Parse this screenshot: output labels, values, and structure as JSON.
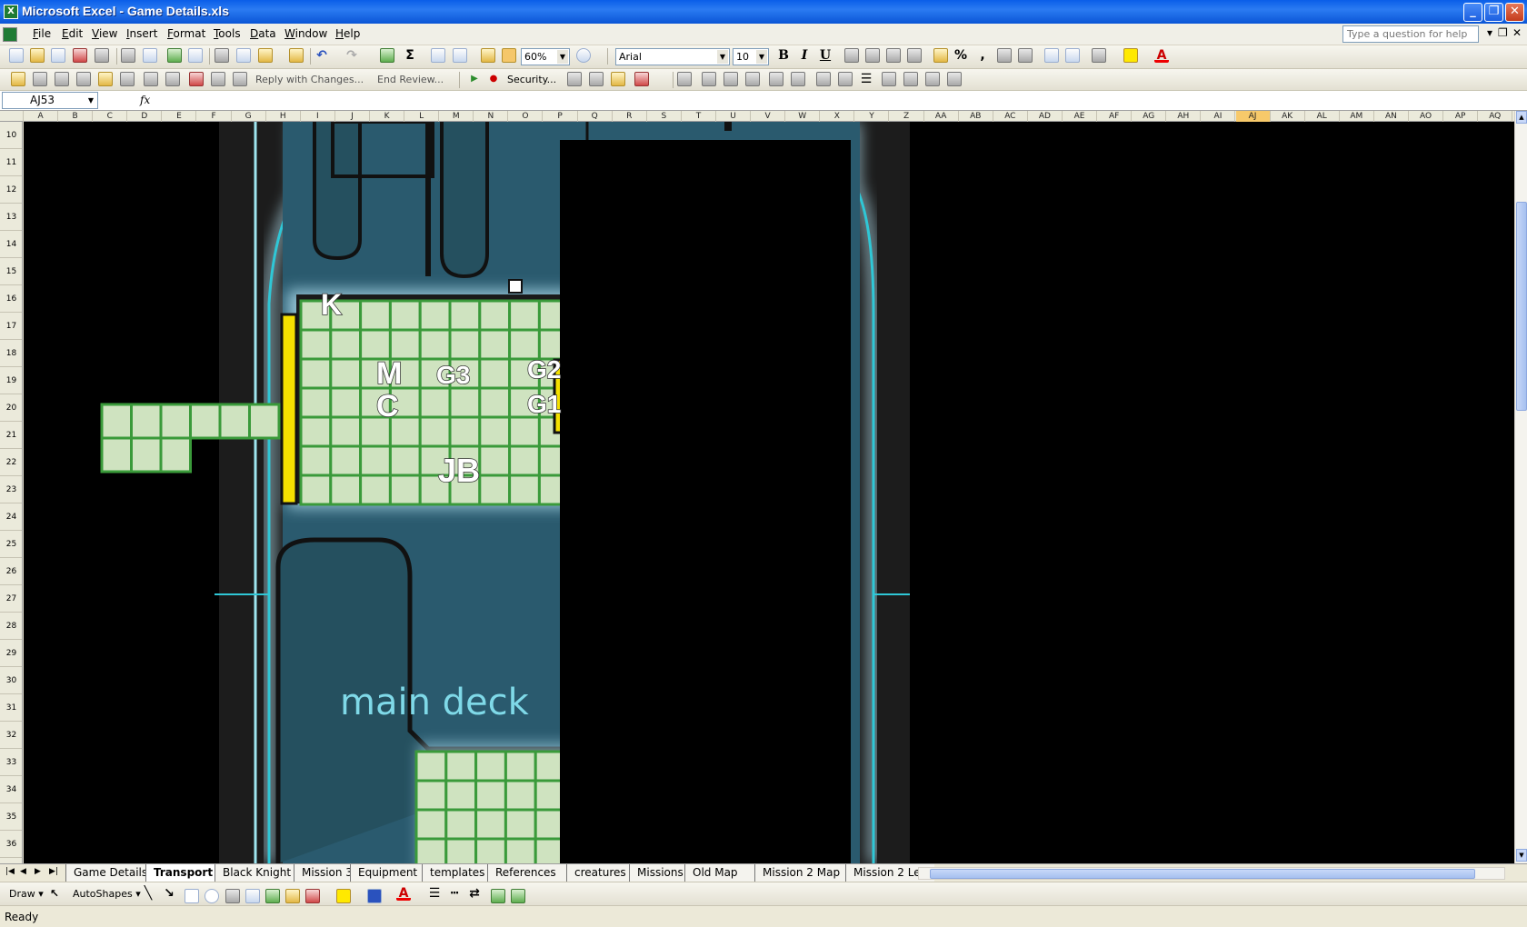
{
  "window": {
    "title": "Microsoft Excel - Game Details.xls",
    "app_icon": "excel-icon"
  },
  "menubar": {
    "items": [
      "File",
      "Edit",
      "View",
      "Insert",
      "Format",
      "Tools",
      "Data",
      "Window",
      "Help"
    ],
    "help_placeholder": "Type a question for help"
  },
  "toolbar_standard": {
    "zoom": "60%"
  },
  "toolbar_formatting": {
    "font": "Arial",
    "size": "10",
    "bold": "B",
    "italic": "I",
    "underline": "U",
    "percent": "%",
    "comma": ","
  },
  "toolbar_reviewing": {
    "reply": "Reply with Changes...",
    "end_review": "End Review...",
    "security": "Security..."
  },
  "formula_bar": {
    "cell_ref": "AJ53",
    "fx": "fx",
    "content": ""
  },
  "columns": [
    "A",
    "B",
    "C",
    "D",
    "E",
    "F",
    "G",
    "H",
    "I",
    "J",
    "K",
    "L",
    "M",
    "N",
    "O",
    "P",
    "Q",
    "R",
    "S",
    "T",
    "U",
    "V",
    "W",
    "X",
    "Y",
    "Z",
    "AA",
    "AB",
    "AC",
    "AD",
    "AE",
    "AF",
    "AG",
    "AH",
    "AI",
    "AJ",
    "AK",
    "AL",
    "AM",
    "AN",
    "AO",
    "AP",
    "AQ"
  ],
  "active_column": "AJ",
  "rows": [
    "10",
    "11",
    "12",
    "13",
    "14",
    "15",
    "16",
    "17",
    "18",
    "19",
    "20",
    "21",
    "22",
    "23",
    "24",
    "25",
    "26",
    "27",
    "28",
    "29",
    "30",
    "31",
    "32",
    "33",
    "34",
    "35",
    "36"
  ],
  "map": {
    "labels": {
      "k": "K",
      "m": "M",
      "g3": "G3",
      "g2": "G2",
      "c": "C",
      "g1": "G1",
      "jb": "JB",
      "deck": "main deck"
    },
    "colors": {
      "floor": "#2a5a6e",
      "grid_fill": "#cfe3c0",
      "grid_line": "#3a9a3a",
      "door": "#f5e000",
      "glow": "#7fd9e8"
    }
  },
  "sheet_tabs": [
    "Game Details",
    "Transport",
    "Black Knight",
    "Mission 3",
    "Equipment",
    "templates",
    "References",
    "creatures",
    "Missions",
    "Old Map",
    "Mission 2 Map",
    "Mission 2 Leve"
  ],
  "active_sheet": "Transport",
  "drawing_toolbar": {
    "draw": "Draw",
    "autoshapes": "AutoShapes"
  },
  "status": "Ready"
}
